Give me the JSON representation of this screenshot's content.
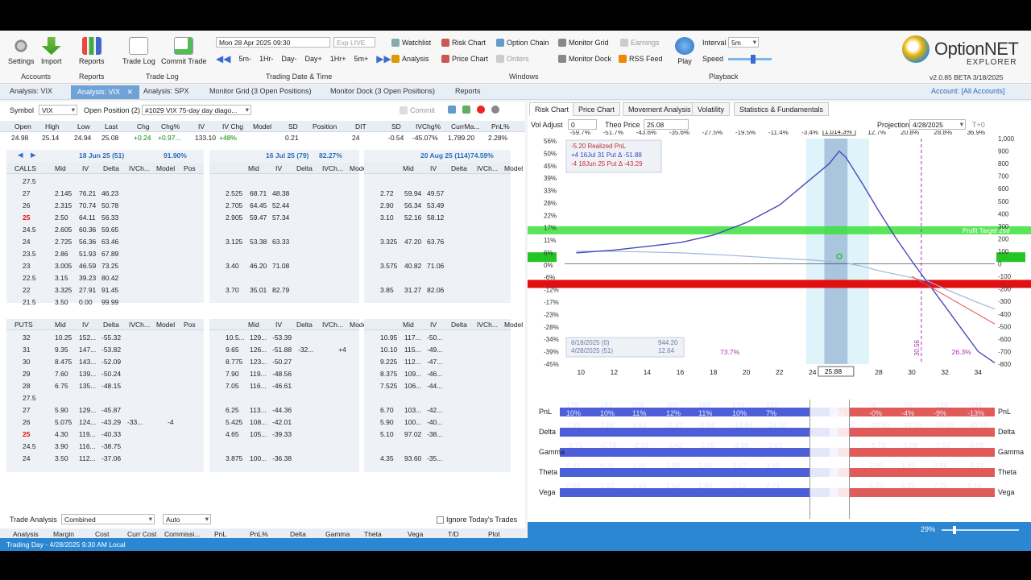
{
  "ribbon": {
    "settings": "Settings",
    "import": "Import",
    "reports": "Reports",
    "accounts_group": "Accounts",
    "reports_group": "Reports",
    "trade_log": "Trade Log",
    "commit_trade": "Commit Trade",
    "trade_log_group": "Trade Log",
    "date_value": "Mon 28 Apr 2025 09:30",
    "exp_live": "Exp LIVE",
    "steps": [
      "5m-",
      "1Hr-",
      "Day-",
      "Day+",
      "1Hr+",
      "5m+"
    ],
    "trading_group": "Trading Date & Time",
    "watchlist": "Watchlist",
    "risk_chart": "Risk Chart",
    "option_chain": "Option Chain",
    "monitor_grid": "Monitor Grid",
    "earnings": "Earnings",
    "analysis": "Analysis",
    "price_chart": "Price Chart",
    "orders": "Orders",
    "monitor_dock": "Monitor Dock",
    "rss_feed": "RSS Feed",
    "windows_group": "Windows",
    "play": "Play",
    "interval_label": "Interval",
    "interval_value": "5m",
    "speed_label": "Speed",
    "playback_group": "Playback",
    "logo_text": "OptionNET",
    "logo_sub": "EXPLORER",
    "version": "v2.0.85 BETA 3/18/2025",
    "account": "Account: [All Accounts]"
  },
  "tabs": [
    "Analysis: VIX",
    "Analysis: VIX",
    "Analysis: SPX",
    "Monitor Grid (3 Open Positions)",
    "Monitor Dock (3 Open Positions)",
    "Reports"
  ],
  "symbol_bar": {
    "symbol_label": "Symbol",
    "symbol": "VIX",
    "open_pos": "Open Position (2)",
    "position_name": "#1029 VIX 75-day day diago...",
    "commit": "Commit"
  },
  "quote": {
    "headers": [
      "Open",
      "High",
      "Low",
      "Last",
      "Chg",
      "Chg%",
      "IV",
      "IV Chg",
      "Model",
      "SD",
      "Position",
      "DIT",
      "SD",
      "IVChg%",
      "CurrMa...",
      "PnL%"
    ],
    "values": [
      "24.98",
      "25.14",
      "24.94",
      "25.08",
      "+0.24",
      "+0.97...",
      "133.10",
      "+48%",
      "",
      "0.21",
      "",
      "24",
      "-0.54",
      "-45.07%",
      "1,789.20",
      "2.28%"
    ]
  },
  "expiries": [
    {
      "label": "18 Jun 25 (51)",
      "pct": "91.90%"
    },
    {
      "label": "16 Jul 25 (79)",
      "pct": "82.27%"
    },
    {
      "label": "20 Aug 25 (114)",
      "pct": "74.59%"
    }
  ],
  "chain_headers": [
    "Mid",
    "IV",
    "Delta",
    "IVCh...",
    "Model",
    "Pos"
  ],
  "calls_label": "CALLS",
  "puts_label": "PUTS",
  "calls": {
    "strikes": [
      "27.5",
      "27",
      "26",
      "25",
      "24.5",
      "24",
      "23.5",
      "23",
      "22.5",
      "22",
      "21.5"
    ],
    "e1": [
      [
        "",
        "",
        "",
        ""
      ],
      [
        "2.145",
        "76.21",
        "46.23",
        ""
      ],
      [
        "2.315",
        "70.74",
        "50.78",
        ""
      ],
      [
        "2.50",
        "64.11",
        "56.33",
        ""
      ],
      [
        "2.605",
        "60.36",
        "59.65",
        ""
      ],
      [
        "2.725",
        "56.36",
        "63.46",
        ""
      ],
      [
        "2.86",
        "51.93",
        "67.89",
        ""
      ],
      [
        "3.005",
        "46.59",
        "73.25",
        ""
      ],
      [
        "3.15",
        "39.23",
        "80.42",
        ""
      ],
      [
        "3.325",
        "27.91",
        "91.45",
        ""
      ],
      [
        "3.50",
        "0.00",
        "99.99",
        ""
      ]
    ],
    "e2": [
      [
        "",
        "",
        "",
        ""
      ],
      [
        "2.525",
        "68.71",
        "48.38",
        ""
      ],
      [
        "2.705",
        "64.45",
        "52.44",
        ""
      ],
      [
        "2.905",
        "59.47",
        "57.34",
        ""
      ],
      [
        "",
        "",
        "",
        ""
      ],
      [
        "3.125",
        "53.38",
        "63.33",
        ""
      ],
      [
        "",
        "",
        "",
        ""
      ],
      [
        "3.40",
        "46.20",
        "71.08",
        ""
      ],
      [
        "",
        "",
        "",
        ""
      ],
      [
        "3.70",
        "35.01",
        "82.79",
        ""
      ],
      [
        "",
        "",
        "",
        ""
      ]
    ],
    "e3": [
      [
        "",
        "",
        "",
        ""
      ],
      [
        "2.72",
        "59.94",
        "49.57",
        ""
      ],
      [
        "2.90",
        "56.34",
        "53.49",
        ""
      ],
      [
        "3.10",
        "52.16",
        "58.12",
        ""
      ],
      [
        "",
        "",
        "",
        ""
      ],
      [
        "3.325",
        "47.20",
        "63.76",
        ""
      ],
      [
        "",
        "",
        "",
        ""
      ],
      [
        "3.575",
        "40.82",
        "71.06",
        ""
      ],
      [
        "",
        "",
        "",
        ""
      ],
      [
        "3.85",
        "31.27",
        "82.06",
        ""
      ],
      [
        "",
        "",
        "",
        ""
      ]
    ]
  },
  "puts": {
    "strikes": [
      "32",
      "31",
      "30",
      "29",
      "28",
      "27.5",
      "27",
      "26",
      "25",
      "24.5",
      "24"
    ],
    "e1": [
      [
        "10.25",
        "152...",
        "-55.32",
        "",
        ""
      ],
      [
        "9.35",
        "147...",
        "-53.82",
        "",
        ""
      ],
      [
        "8.475",
        "143...",
        "-52.09",
        "",
        ""
      ],
      [
        "7.60",
        "139...",
        "-50.24",
        "",
        ""
      ],
      [
        "6.75",
        "135...",
        "-48.15",
        "",
        ""
      ],
      [
        "",
        "",
        "",
        "",
        ""
      ],
      [
        "5.90",
        "129...",
        "-45.87",
        "",
        ""
      ],
      [
        "5.075",
        "124...",
        "-43.29",
        "-33...",
        "-4"
      ],
      [
        "4.30",
        "119...",
        "-40.33",
        "",
        ""
      ],
      [
        "3.90",
        "116...",
        "-38.75",
        "",
        ""
      ],
      [
        "3.50",
        "112...",
        "-37.06",
        "",
        ""
      ]
    ],
    "e2": [
      [
        "10.5...",
        "129...",
        "-53.39",
        "",
        ""
      ],
      [
        "9.65",
        "126...",
        "-51.88",
        "-32...",
        "+4"
      ],
      [
        "8.775",
        "123...",
        "-50.27",
        "",
        ""
      ],
      [
        "7.90",
        "119...",
        "-48.56",
        "",
        ""
      ],
      [
        "7.05",
        "116...",
        "-46.61",
        "",
        ""
      ],
      [
        "",
        "",
        "",
        "",
        ""
      ],
      [
        "6.25",
        "113...",
        "-44.36",
        "",
        ""
      ],
      [
        "5.425",
        "108...",
        "-42.01",
        "",
        ""
      ],
      [
        "4.65",
        "105...",
        "-39.33",
        "",
        ""
      ],
      [
        "",
        "",
        "",
        "",
        ""
      ],
      [
        "3.875",
        "100...",
        "-36.38",
        "",
        ""
      ]
    ],
    "e3": [
      [
        "10.95",
        "117...",
        "-50...",
        "",
        ""
      ],
      [
        "10.10",
        "115...",
        "-49...",
        "",
        ""
      ],
      [
        "9.225",
        "112...",
        "-47...",
        "",
        ""
      ],
      [
        "8.375",
        "109...",
        "-46...",
        "",
        ""
      ],
      [
        "7.525",
        "106...",
        "-44...",
        "",
        ""
      ],
      [
        "",
        "",
        "",
        "",
        ""
      ],
      [
        "6.70",
        "103...",
        "-42...",
        "",
        ""
      ],
      [
        "5.90",
        "100...",
        "-40...",
        "",
        ""
      ],
      [
        "5.10",
        "97.02",
        "-38...",
        "",
        ""
      ],
      [
        "",
        "",
        "",
        "",
        ""
      ],
      [
        "4.35",
        "93.60",
        "-35...",
        "",
        ""
      ]
    ]
  },
  "trade_analysis": {
    "label": "Trade Analysis",
    "combined": "Combined",
    "auto": "Auto",
    "ignore": "Ignore Today's Trades",
    "headers": [
      "Analysis",
      "Margin",
      "Cost",
      "Curr Cost",
      "Commissi...",
      "PnL",
      "PnL%",
      "Delta",
      "Gamma",
      "Theta",
      "Vega",
      "T/D",
      "Plot"
    ],
    "position": [
      "Position",
      "1,789.20",
      "-1,789.20",
      "1,830.00",
      "5.20",
      "40.80",
      "2.28%",
      "-34.34",
      "-2.71",
      "3.40",
      "3.85",
      "0.1",
      ""
    ],
    "model": [
      "Model",
      "",
      "",
      "",
      "",
      "",
      "",
      "0.00",
      "0.00",
      "0.00",
      "0.00",
      "0",
      ""
    ]
  },
  "right_tabs": [
    "Risk Chart",
    "Price Chart",
    "Movement Analysis",
    "Volatility",
    "Statistics & Fundamentals"
  ],
  "risk_bar": {
    "vol_adjust": "Vol Adjust",
    "vol_value": "0",
    "theo_label": "Theo Price",
    "theo_value": "25.08",
    "projection": "Projection",
    "proj_date": "4/28/2025",
    "tplus": "T+0"
  },
  "chart_data": {
    "type": "line",
    "x_ticks": [
      "10",
      "12",
      "14",
      "16",
      "18",
      "20",
      "22",
      "24",
      "26",
      "28",
      "30",
      "32",
      "34"
    ],
    "top_pct": [
      "-59.7%",
      "-51.7%",
      "-43.6%",
      "-35.6%",
      "-27.5%",
      "-19.5%",
      "-11.4%",
      "-3.4%",
      "4.3%",
      "12.7%",
      "20.8%",
      "28.8%",
      "36.9%"
    ],
    "left_pct": [
      "56%",
      "50%",
      "45%",
      "39%",
      "33%",
      "28%",
      "22%",
      "17%",
      "11%",
      "6%",
      "0%",
      "-6%",
      "-12%",
      "-17%",
      "-23%",
      "-28%",
      "-34%",
      "-39%",
      "-45%"
    ],
    "right_ticks": [
      "1,000",
      "900",
      "800",
      "700",
      "600",
      "500",
      "400",
      "300",
      "200",
      "100",
      "0",
      "-100",
      "-200",
      "-300",
      "-400",
      "-500",
      "-600",
      "-700",
      "-800"
    ],
    "xlim": [
      9,
      35
    ],
    "ylim": [
      -800,
      1000
    ],
    "current_price": "25.88",
    "current_pct": "1.014.3%",
    "profit_target": "Profit Target 268",
    "profit_target_value": 268,
    "stop_loss_value": -160,
    "legend": {
      "realized": "-5.20 Realized PnL",
      "l1": "+4 16Jul 31 Put Δ -51.88",
      "l2": "-4 18Jun 25 Put Δ -43.29"
    },
    "marker_box": [
      "6/18/2025 (0)",
      "4/28/2025 (51)",
      "944.20",
      "12.64"
    ],
    "pct_left": "73.7%",
    "pct_right": "26.3%",
    "vline_label": "30.56",
    "expiry_line": [
      [
        9.7,
        88
      ],
      [
        12,
        110
      ],
      [
        14,
        140
      ],
      [
        16,
        170
      ],
      [
        18,
        230
      ],
      [
        20,
        330
      ],
      [
        22,
        470
      ],
      [
        23,
        580
      ],
      [
        24,
        690
      ],
      [
        25,
        800
      ],
      [
        25.6,
        900
      ],
      [
        26,
        850
      ],
      [
        27,
        640
      ],
      [
        28,
        420
      ],
      [
        29,
        210
      ],
      [
        30,
        20
      ],
      [
        31,
        -160
      ],
      [
        32,
        -340
      ],
      [
        33,
        -520
      ],
      [
        34,
        -700
      ],
      [
        35,
        -790
      ]
    ],
    "t0_line": [
      [
        9.7,
        100
      ],
      [
        12,
        100
      ],
      [
        14,
        95
      ],
      [
        16,
        88
      ],
      [
        18,
        75
      ],
      [
        20,
        60
      ],
      [
        22,
        45
      ],
      [
        24,
        30
      ],
      [
        25.9,
        10
      ],
      [
        27,
        -20
      ],
      [
        28,
        -55
      ],
      [
        30,
        -110
      ],
      [
        31,
        -140
      ],
      [
        32,
        -200
      ],
      [
        34,
        -310
      ],
      [
        35,
        -360
      ]
    ],
    "series": [
      {
        "name": "+4 16Jul 31 Put",
        "values": []
      },
      {
        "name": "-4 18Jun 25 Put",
        "values": []
      }
    ]
  },
  "strip": {
    "rows": [
      "PnL",
      "Delta",
      "Gamma",
      "Theta",
      "Vega"
    ],
    "pnl": [
      "178\n10%",
      "193\n10%",
      "206\n11%",
      "209\n12%",
      "199\n11%",
      "174\n10%",
      "132\n7%",
      "",
      "13\n1%",
      "-4\n-0%",
      "-70\n-4%",
      "-154\n-9%",
      "-234\n-13%"
    ],
    "delta": [
      "7.55",
      "7.58",
      "4.44",
      "-1.37",
      "-8.84",
      "-18.84",
      "-24.50",
      "",
      "-36.40",
      "-40.80",
      "-43.59",
      "-45.19",
      "-45.76"
    ],
    "gamma": [
      "-0.75",
      "-0.78",
      "-2.31",
      "-3.42",
      "-3.95",
      "-3.98",
      "-3.63",
      "",
      "-2.44",
      "-1.72",
      "-1.08",
      "-0.53",
      "-0.06"
    ],
    "theta": [
      "0.01",
      "0.36",
      "1.02",
      "1.85",
      "2.66",
      "3.27",
      "3.58",
      "",
      "3.24",
      "2.60",
      "1.80",
      "0.86",
      "-0.14"
    ],
    "vega": [
      "0.88",
      "1.22",
      "1.44",
      "1.62",
      "1.84",
      "2.19",
      "2.71",
      "",
      "4.20",
      "5.20",
      "6.20",
      "7.20",
      "8.16"
    ]
  },
  "zoom": "29%",
  "status": "Trading Day - 4/28/2025 9:30 AM Local",
  "colors": {
    "accent": "#2b87d1",
    "green": "#23c423",
    "red": "#e01010",
    "expiry": "#4a48b8",
    "t0": "#9eb6de"
  }
}
